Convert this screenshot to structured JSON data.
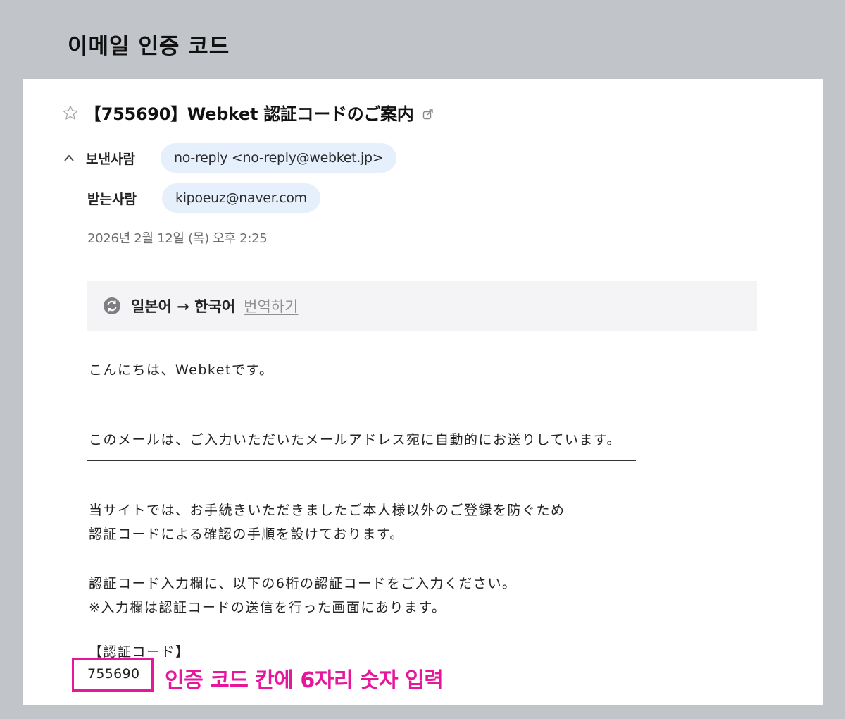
{
  "page": {
    "heading": "이메일 인증 코드"
  },
  "email": {
    "subject": "【755690】Webket 認証コードのご案内",
    "sender_label": "보낸사람",
    "sender_value": "no-reply <no-reply@webket.jp>",
    "recipient_label": "받는사람",
    "recipient_value": "kipoeuz@naver.com",
    "date": "2026년 2월 12일 (목) 오후 2:25"
  },
  "translation": {
    "lang_pair": "일본어 → 한국어",
    "link": "번역하기"
  },
  "body": {
    "greeting": "こんにちは、Webketです。",
    "notice": "このメールは、ご入力いただいたメールアドレス宛に自動的にお送りしています。",
    "para1_line1": "当サイトでは、お手続きいただきましたご本人様以外のご登録を防ぐため",
    "para1_line2": "認証コードによる確認の手順を設けております。",
    "para2_line1": "認証コード入力欄に、以下の6桁の認証コードをご入力ください。",
    "para2_line2": "※入力欄は認証コードの送信を行った画面にあります。",
    "code_heading": "【認証コード】",
    "code": "755690"
  },
  "annotation": {
    "text": "인증 코드 칸에 6자리 숫자 입력"
  },
  "colors": {
    "background": "#c1c5c9",
    "chip": "#e6f0fd",
    "highlight": "#e6179a",
    "translate_bar": "#f4f4f6"
  },
  "icons": [
    "star-icon",
    "external-link-icon",
    "collapse-chevron-icon",
    "translate-icon"
  ]
}
